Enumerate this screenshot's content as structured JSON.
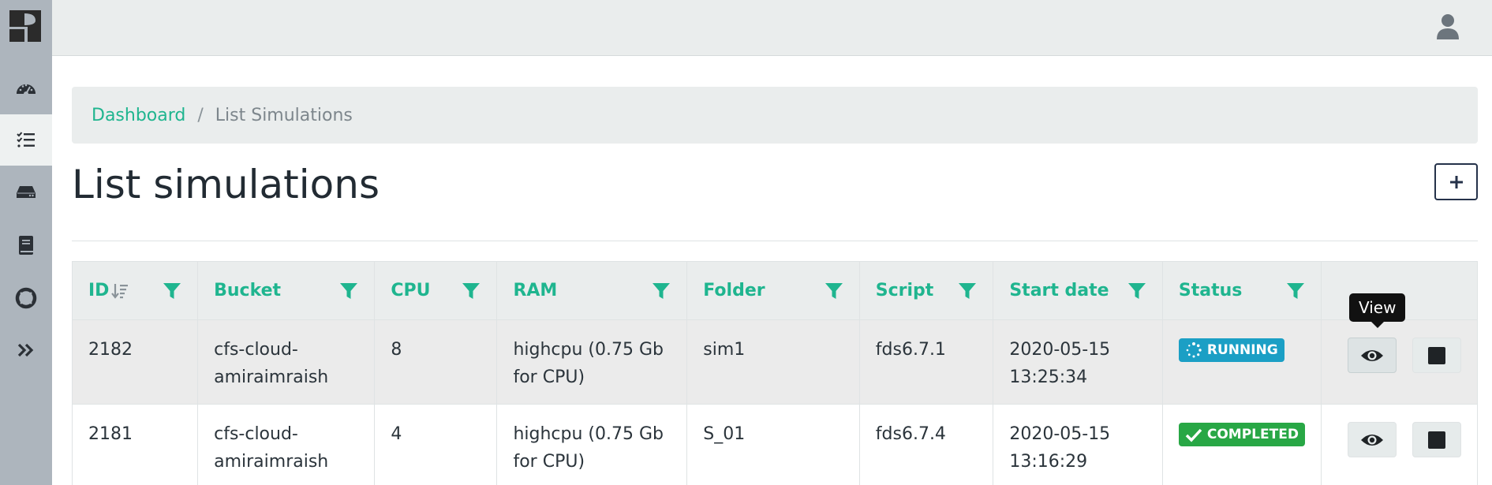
{
  "sidebar": {
    "items": [
      {
        "name": "dashboard",
        "icon": "speedometer-icon"
      },
      {
        "name": "simulations",
        "icon": "checklist-icon",
        "active": true
      },
      {
        "name": "storage",
        "icon": "hard-drive-icon"
      },
      {
        "name": "docs",
        "icon": "book-icon"
      },
      {
        "name": "support",
        "icon": "lifebuoy-icon"
      },
      {
        "name": "expand",
        "icon": "double-chevron-right-icon"
      }
    ]
  },
  "breadcrumb": {
    "home": "Dashboard",
    "separator": "/",
    "current": "List Simulations"
  },
  "page": {
    "title": "List simulations",
    "add_label": "+"
  },
  "table": {
    "columns": [
      "ID",
      "Bucket",
      "CPU",
      "RAM",
      "Folder",
      "Script",
      "Start date",
      "Status"
    ],
    "rows": [
      {
        "id": "2182",
        "bucket": "cfs-cloud-amiraimraish",
        "cpu": "8",
        "ram": "highcpu (0.75 Gb for CPU)",
        "folder": "sim1",
        "script": "fds6.7.1",
        "start_date": "2020-05-15 13:25:34",
        "status": "RUNNING"
      },
      {
        "id": "2181",
        "bucket": "cfs-cloud-amiraimraish",
        "cpu": "4",
        "ram": "highcpu (0.75 Gb for CPU)",
        "folder": "S_01",
        "script": "fds6.7.4",
        "start_date": "2020-05-15 13:16:29",
        "status": "COMPLETED"
      }
    ]
  },
  "tooltip": {
    "text": "View"
  },
  "colors": {
    "accent": "#1fb58f",
    "running": "#1b9fc5",
    "completed": "#28a745",
    "sidebar": "#adb5bd"
  }
}
